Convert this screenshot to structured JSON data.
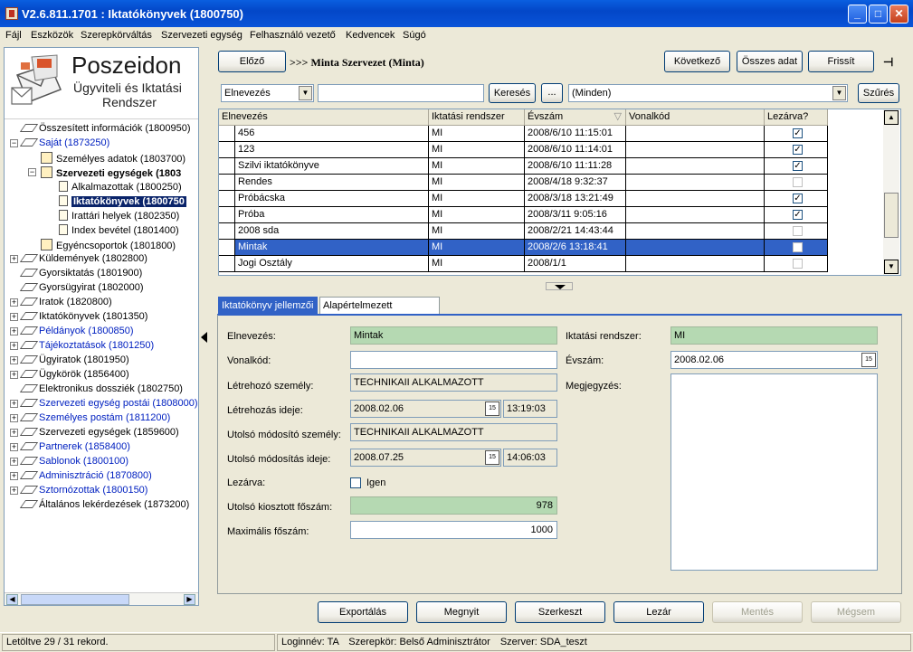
{
  "window": {
    "title": "V2.6.811.1701 : Iktatókönyvek (1800750)",
    "minimize": "_",
    "maximize": "□",
    "close": "✕"
  },
  "menu": [
    "Fájl",
    "Eszközök",
    "Szerepkörváltás",
    "Szervezeti egység",
    "Felhasználó vezető",
    "Kedvencek",
    "Súgó"
  ],
  "logo": {
    "line1": "Poszeidon",
    "line2": "Ügyviteli és Iktatási",
    "line3": "Rendszer"
  },
  "tree": [
    {
      "label": "Összesített információk (1800950)",
      "level": 0,
      "icon": "diamond",
      "expander": ""
    },
    {
      "label": "Saját (1873250)",
      "level": 0,
      "icon": "diamond",
      "expander": "−",
      "color": "blue"
    },
    {
      "label": "Személyes adatok (1803700)",
      "level": 1,
      "icon": "page2",
      "expander": ""
    },
    {
      "label": "Szervezeti egységek (1803",
      "level": 1,
      "icon": "page2",
      "expander": "−",
      "bold": true
    },
    {
      "label": "Alkalmazottak (1800250)",
      "level": 2,
      "icon": "page",
      "expander": ""
    },
    {
      "label": "Iktatókönyvek (1800750",
      "level": 2,
      "icon": "page",
      "expander": "",
      "bold": true,
      "selected": true
    },
    {
      "label": "Irattári helyek (1802350)",
      "level": 2,
      "icon": "page",
      "expander": ""
    },
    {
      "label": "Index bevétel (1801400)",
      "level": 2,
      "icon": "page",
      "expander": ""
    },
    {
      "label": "Egyéncsoportok (1801800)",
      "level": 1,
      "icon": "page2",
      "expander": ""
    },
    {
      "label": "Küldemények (1802800)",
      "level": 0,
      "icon": "diamond",
      "expander": "+"
    },
    {
      "label": "Gyorsiktatás (1801900)",
      "level": 0,
      "icon": "diamond",
      "expander": ""
    },
    {
      "label": "Gyorsügyirat (1802000)",
      "level": 0,
      "icon": "diamond",
      "expander": ""
    },
    {
      "label": "Iratok (1820800)",
      "level": 0,
      "icon": "diamond",
      "expander": "+"
    },
    {
      "label": "Iktatókönyvek (1801350)",
      "level": 0,
      "icon": "diamond",
      "expander": "+"
    },
    {
      "label": "Példányok (1800850)",
      "level": 0,
      "icon": "diamond",
      "expander": "+",
      "color": "blue"
    },
    {
      "label": "Tájékoztatások (1801250)",
      "level": 0,
      "icon": "diamond",
      "expander": "+",
      "color": "blue"
    },
    {
      "label": "Ügyiratok (1801950)",
      "level": 0,
      "icon": "diamond",
      "expander": "+"
    },
    {
      "label": "Ügykörök (1856400)",
      "level": 0,
      "icon": "diamond",
      "expander": "+"
    },
    {
      "label": "Elektronikus dossziék (1802750)",
      "level": 0,
      "icon": "diamond",
      "expander": ""
    },
    {
      "label": "Szervezeti egység postái (1808000)",
      "level": 0,
      "icon": "diamond",
      "expander": "+",
      "color": "blue"
    },
    {
      "label": "Személyes postám (1811200)",
      "level": 0,
      "icon": "diamond",
      "expander": "+",
      "color": "blue"
    },
    {
      "label": "Szervezeti egységek (1859600)",
      "level": 0,
      "icon": "diamond",
      "expander": "+"
    },
    {
      "label": "Partnerek (1858400)",
      "level": 0,
      "icon": "diamond",
      "expander": "+",
      "color": "blue"
    },
    {
      "label": "Sablonok (1800100)",
      "level": 0,
      "icon": "diamond",
      "expander": "+",
      "color": "blue"
    },
    {
      "label": "Adminisztráció (1870800)",
      "level": 0,
      "icon": "diamond",
      "expander": "+",
      "color": "blue"
    },
    {
      "label": "Sztornózottak (1800150)",
      "level": 0,
      "icon": "diamond",
      "expander": "+",
      "color": "blue"
    },
    {
      "label": "Általános lekérdezések (1873200)",
      "level": 0,
      "icon": "diamond",
      "expander": ""
    }
  ],
  "nav": {
    "prev": "Előző",
    "breadcrumb": ">>> Minta Szervezet (Minta)",
    "next": "Következő",
    "all_data": "Összes adat",
    "refresh": "Frissít",
    "pin": "⊣"
  },
  "filter": {
    "field": "Elnevezés",
    "search_value": "",
    "search_button": "Keresés",
    "ellipsis": "...",
    "scope": "(Minden)",
    "filter_button": "Szűrés"
  },
  "grid": {
    "headers": [
      "Elnevezés",
      "Iktatási rendszer",
      "Évszám",
      "Vonalkód",
      "Lezárva?"
    ],
    "sort_indicator": "▽",
    "rows": [
      {
        "name": "456",
        "system": "MI",
        "year": "2008/6/10 11:15:01",
        "barcode": "",
        "closed": true
      },
      {
        "name": "123",
        "system": "MI",
        "year": "2008/6/10 11:14:01",
        "barcode": "",
        "closed": true
      },
      {
        "name": "Szilvi iktatókönyve",
        "system": "MI",
        "year": "2008/6/10 11:11:28",
        "barcode": "",
        "closed": true
      },
      {
        "name": "Rendes",
        "system": "MI",
        "year": "2008/4/18 9:32:37",
        "barcode": "",
        "closed": false
      },
      {
        "name": "Próbácska",
        "system": "MI",
        "year": "2008/3/18 13:21:49",
        "barcode": "",
        "closed": true
      },
      {
        "name": "Próba",
        "system": "MI",
        "year": "2008/3/11 9:05:16",
        "barcode": "",
        "closed": true
      },
      {
        "name": "2008 sda",
        "system": "MI",
        "year": "2008/2/21 14:43:44",
        "barcode": "",
        "closed": false
      },
      {
        "name": "Mintak",
        "system": "MI",
        "year": "2008/2/6 13:18:41",
        "barcode": "",
        "closed": false,
        "selected": true
      },
      {
        "name": "Jogi Osztály",
        "system": "MI",
        "year": "2008/1/1",
        "barcode": "",
        "closed": false
      }
    ]
  },
  "tabs": [
    "Iktatókönyv jellemzői",
    "Alapértelmezett hozzáférés"
  ],
  "form": {
    "name_label": "Elnevezés:",
    "name_value": "Mintak",
    "barcode_label": "Vonalkód:",
    "barcode_value": "",
    "creator_label": "Létrehozó személy:",
    "creator_value": "TECHNIKAII ALKALMAZOTT",
    "created_label": "Létrehozás ideje:",
    "created_date": "2008.02.06",
    "created_time": "13:19:03",
    "modifier_label": "Utolsó módosító személy:",
    "modifier_value": "TECHNIKAII ALKALMAZOTT",
    "modified_label": "Utolsó módosítás ideje:",
    "modified_date": "2008.07.25",
    "modified_time": "14:06:03",
    "closed_label": "Lezárva:",
    "closed_option": "Igen",
    "last_main_label": "Utolsó kiosztott főszám:",
    "last_main_value": "978",
    "max_main_label": "Maximális főszám:",
    "max_main_value": "1000",
    "system_label": "Iktatási rendszer:",
    "system_value": "MI",
    "year_label": "Évszám:",
    "year_value": "2008.02.06",
    "note_label": "Megjegyzés:",
    "note_value": "",
    "cal_icon": "15"
  },
  "actions": [
    "Exportálás",
    "Megnyit",
    "Szerkeszt",
    "Lezár",
    "Mentés",
    "Mégsem"
  ],
  "status": {
    "records": "Letöltve 29 / 31 rekord.",
    "login": "Loginnév: TA",
    "role": "Szerepkör: Belső Adminisztrátor",
    "server": "Szerver: SDA_teszt"
  },
  "colors": {
    "title_bar": "#0a54d8",
    "selection": "#3162c6",
    "readonly_green": "#b5d9b2",
    "link_blue": "#0020c0"
  }
}
